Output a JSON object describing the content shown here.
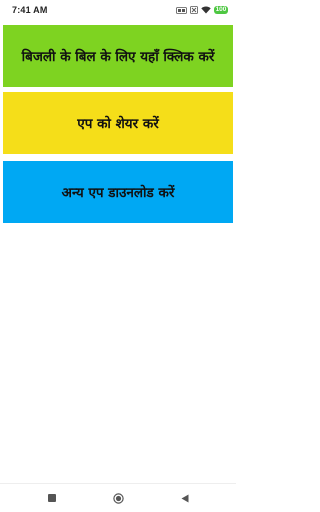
{
  "status_bar": {
    "time": "7:41 AM",
    "battery_level": "100",
    "icons": [
      "hd-volte-icon",
      "sim-icon",
      "wifi-icon",
      "battery-icon"
    ]
  },
  "menu": {
    "items": [
      {
        "label": "बिजली के बिल के लिए यहाँ क्लिक करें",
        "color": "#7ed321"
      },
      {
        "label": "एप को शेयर करें",
        "color": "#f5de19"
      },
      {
        "label": "अन्य एप डाउनलोड करें",
        "color": "#00a8f3"
      }
    ]
  },
  "nav_bar": {
    "icons": [
      "recent-apps-icon",
      "home-icon",
      "back-icon"
    ]
  }
}
